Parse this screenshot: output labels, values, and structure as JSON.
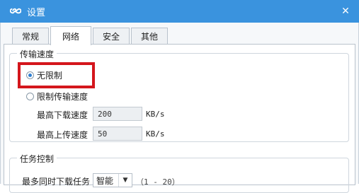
{
  "window": {
    "title": "设置",
    "close_glyph": "✕"
  },
  "tabs": [
    {
      "label": "常规",
      "active": false
    },
    {
      "label": "网络",
      "active": true
    },
    {
      "label": "安全",
      "active": false
    },
    {
      "label": "其他",
      "active": false
    }
  ],
  "transfer_speed": {
    "group_label": "传输速度",
    "option_unlimited": "无限制",
    "option_limited": "限制传输速度",
    "selected": "unlimited",
    "max_download_label": "最高下载速度",
    "max_download_value": "200",
    "max_upload_label": "最高上传速度",
    "max_upload_value": "50",
    "unit": "KB/s"
  },
  "task_control": {
    "group_label": "任务控制",
    "max_tasks_label": "最多同时下载任务",
    "max_tasks_value": "智能",
    "range_hint": "（1 - 20）"
  },
  "colors": {
    "titlebar": "#3a93de",
    "highlight": "#d4161c"
  },
  "icons": {
    "app": "infinity-logo-icon",
    "close": "close-icon",
    "dropdown": "chevron-down-icon"
  }
}
